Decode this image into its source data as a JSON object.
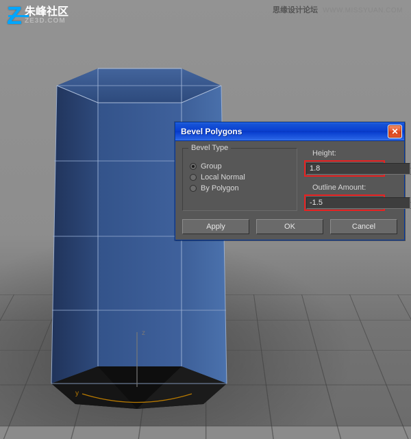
{
  "watermark": {
    "logo_cn": "朱峰社区",
    "logo_en": "ZE3D.COM",
    "right_text": "思缘设计论坛",
    "right_url": "WWW.MISSYUAN.COM"
  },
  "dialog": {
    "title": "Bevel Polygons",
    "group_label": "Bevel Type",
    "radios": [
      {
        "label": "Group",
        "checked": true
      },
      {
        "label": "Local Normal",
        "checked": false
      },
      {
        "label": "By Polygon",
        "checked": false
      }
    ],
    "height_label": "Height:",
    "height_value": "1.8",
    "outline_label": "Outline Amount:",
    "outline_value": "-1.5",
    "buttons": {
      "apply": "Apply",
      "ok": "OK",
      "cancel": "Cancel"
    }
  },
  "colors": {
    "highlight": "#e92121",
    "titlebar": "#0a3fd0"
  }
}
